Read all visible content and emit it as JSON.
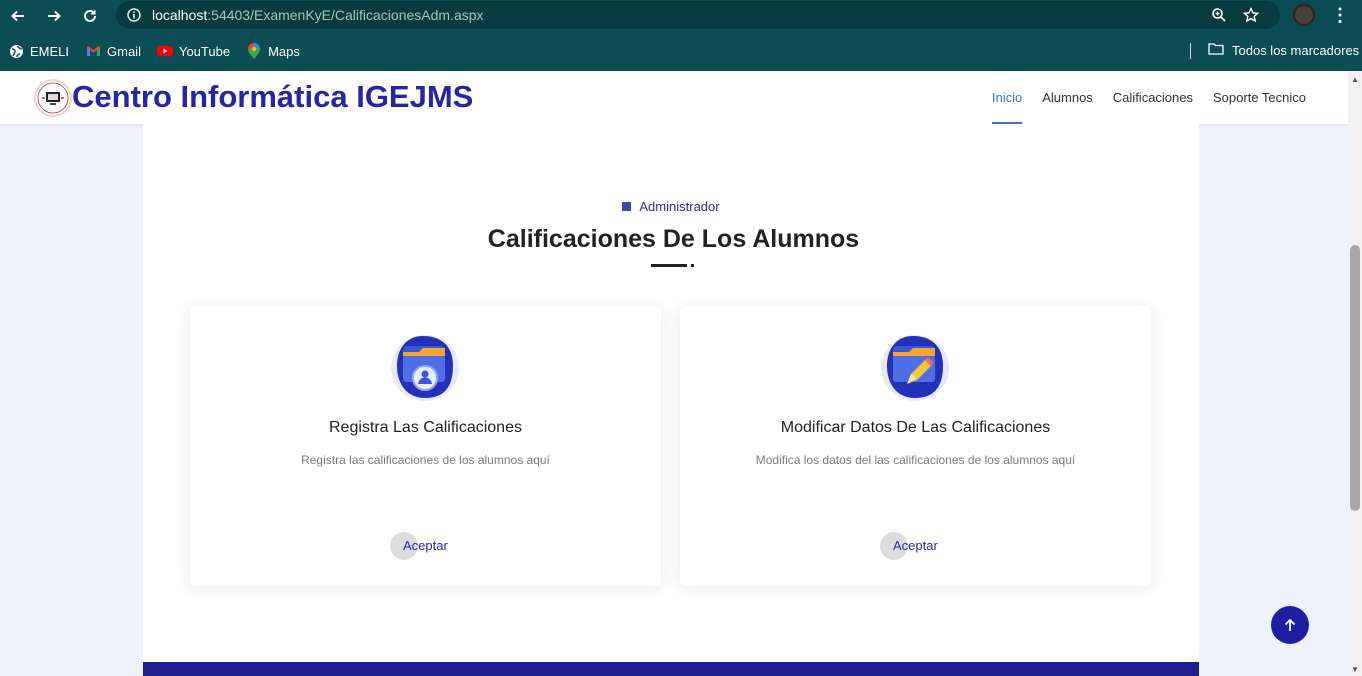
{
  "browser": {
    "url_host": "localhost",
    "url_rest": ":54403/ExamenKyE/CalificacionesAdm.aspx",
    "bookmarks": [
      {
        "label": "EMELI",
        "icon": "globe-icon"
      },
      {
        "label": "Gmail",
        "icon": "gmail-icon"
      },
      {
        "label": "YouTube",
        "icon": "youtube-icon"
      },
      {
        "label": "Maps",
        "icon": "maps-icon"
      }
    ],
    "all_bookmarks": "Todos los marcadores"
  },
  "header": {
    "brand": "Centro Informática IGEJMS",
    "nav": [
      {
        "label": "Inicio",
        "active": true
      },
      {
        "label": "Alumnos",
        "active": false
      },
      {
        "label": "Calificaciones",
        "active": false
      },
      {
        "label": "Soporte Tecnico",
        "active": false
      }
    ]
  },
  "section": {
    "eyebrow": "Administrador",
    "title": "Calificaciones De Los Alumnos"
  },
  "cards": [
    {
      "title": "Registra Las Calificaciones",
      "description": "Registra las calificaciones de los alumnos aquí",
      "button": "Aceptar",
      "icon": "folder-user-icon"
    },
    {
      "title": "Modificar Datos De Las Calificaciones",
      "description": "Modifica los datos del las calificaciones de los alumnos aquí",
      "button": "Aceptar",
      "icon": "folder-edit-icon"
    }
  ],
  "colors": {
    "accent": "#2525a8",
    "chrome": "#0b4d52",
    "active_nav": "#3d6fd6"
  }
}
